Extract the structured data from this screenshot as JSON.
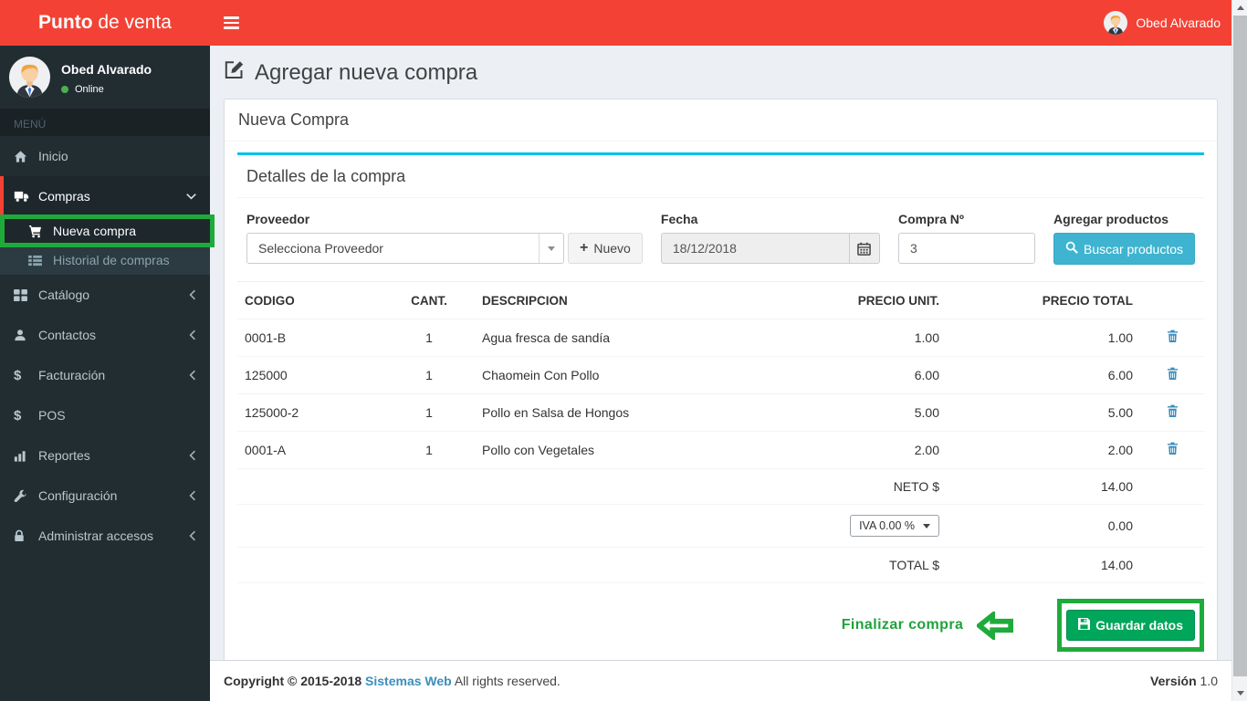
{
  "header": {
    "brand_bold": "Punto",
    "brand_rest": " de venta",
    "user_name": "Obed Alvarado"
  },
  "sidebar": {
    "user_name": "Obed Alvarado",
    "user_status": "Online",
    "menu_label": "MENÚ",
    "items": [
      {
        "label": "Inicio"
      },
      {
        "label": "Compras"
      },
      {
        "label": "Nueva compra"
      },
      {
        "label": "Historial de compras"
      },
      {
        "label": "Catálogo"
      },
      {
        "label": "Contactos"
      },
      {
        "label": "Facturación"
      },
      {
        "label": "POS"
      },
      {
        "label": "Reportes"
      },
      {
        "label": "Configuración"
      },
      {
        "label": "Administrar accesos"
      }
    ]
  },
  "page": {
    "title": "Agregar nueva compra"
  },
  "panel": {
    "title": "Nueva Compra",
    "section_title": "Detalles de la compra"
  },
  "form": {
    "proveedor_label": "Proveedor",
    "proveedor_value": "Selecciona Proveedor",
    "nuevo_button": "Nuevo",
    "fecha_label": "Fecha",
    "fecha_value": "18/12/2018",
    "compra_label": "Compra Nº",
    "compra_value": "3",
    "agregar_label": "Agregar productos",
    "buscar_button": "Buscar productos"
  },
  "table": {
    "headers": {
      "codigo": "CODIGO",
      "cant": "CANT.",
      "descripcion": "DESCRIPCION",
      "precio_unit": "PRECIO UNIT.",
      "precio_total": "PRECIO TOTAL"
    },
    "rows": [
      {
        "codigo": "0001-B",
        "cant": "1",
        "descripcion": "Agua fresca de sandía",
        "precio_unit": "1.00",
        "precio_total": "1.00"
      },
      {
        "codigo": "125000",
        "cant": "1",
        "descripcion": "Chaomein Con Pollo",
        "precio_unit": "6.00",
        "precio_total": "6.00"
      },
      {
        "codigo": "125000-2",
        "cant": "1",
        "descripcion": "Pollo en Salsa de Hongos",
        "precio_unit": "5.00",
        "precio_total": "5.00"
      },
      {
        "codigo": "0001-A",
        "cant": "1",
        "descripcion": "Pollo con Vegetales",
        "precio_unit": "2.00",
        "precio_total": "2.00"
      }
    ],
    "totals": {
      "neto_label": "NETO $",
      "neto_value": "14.00",
      "iva_select": "IVA 0.00 %",
      "iva_value": "0.00",
      "total_label": "TOTAL $",
      "total_value": "14.00"
    }
  },
  "actions": {
    "finalizar_label": "Finalizar compra",
    "guardar_button": "Guardar datos"
  },
  "footer": {
    "copyright": "Copyright © 2015-2018",
    "brand": "Sistemas Web",
    "rights": "All rights reserved.",
    "version_label": "Versión",
    "version_value": "1.0"
  },
  "colors": {
    "header_red": "#f34235",
    "accent_cyan": "#00c0ef",
    "info_button": "#3eb4d0",
    "success_green": "#00a65a",
    "annotation_green": "#1fab3c",
    "link_blue": "#3c8dbc"
  }
}
